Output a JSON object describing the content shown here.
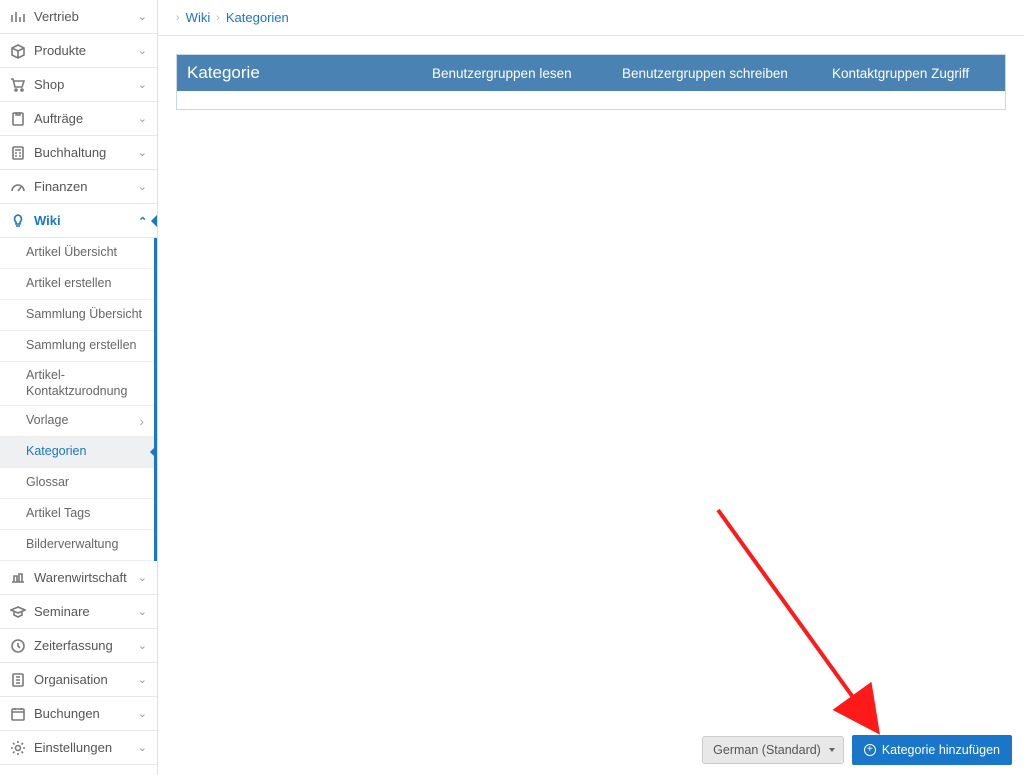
{
  "sidebar": {
    "items": [
      {
        "label": "Vertrieb",
        "icon": "bars-icon",
        "expandable": true
      },
      {
        "label": "Produkte",
        "icon": "box-icon",
        "expandable": true
      },
      {
        "label": "Shop",
        "icon": "cart-icon",
        "expandable": true
      },
      {
        "label": "Aufträge",
        "icon": "clipboard-icon",
        "expandable": true
      },
      {
        "label": "Buchhaltung",
        "icon": "calc-icon",
        "expandable": true
      },
      {
        "label": "Finanzen",
        "icon": "gauge-icon",
        "expandable": true
      },
      {
        "label": "Wiki",
        "icon": "bulb-icon",
        "expandable": true,
        "active": true,
        "children": [
          {
            "label": "Artikel Übersicht"
          },
          {
            "label": "Artikel erstellen"
          },
          {
            "label": "Sammlung Übersicht"
          },
          {
            "label": "Sammlung erstellen"
          },
          {
            "label": "Artikel-Kontaktzurodnung"
          },
          {
            "label": "Vorlage",
            "has_sub": true
          },
          {
            "label": "Kategorien",
            "active": true
          },
          {
            "label": "Glossar"
          },
          {
            "label": "Artikel Tags"
          },
          {
            "label": "Bilderverwaltung"
          }
        ]
      },
      {
        "label": "Warenwirtschaft",
        "icon": "pallet-icon",
        "expandable": true
      },
      {
        "label": "Seminare",
        "icon": "grad-icon",
        "expandable": true
      },
      {
        "label": "Zeiterfassung",
        "icon": "clock-icon",
        "expandable": true
      },
      {
        "label": "Organisation",
        "icon": "org-icon",
        "expandable": true
      },
      {
        "label": "Buchungen",
        "icon": "cal-icon",
        "expandable": true
      },
      {
        "label": "Einstellungen",
        "icon": "gear-icon",
        "expandable": true
      }
    ]
  },
  "breadcrumb": {
    "items": [
      {
        "label": "Wiki",
        "link": true
      },
      {
        "label": "Kategorien",
        "link": true
      }
    ]
  },
  "table": {
    "headers": {
      "category": "Kategorie",
      "read_groups": "Benutzergruppen lesen",
      "write_groups": "Benutzergruppen schreiben",
      "contact_groups": "Kontaktgruppen Zugriff"
    },
    "rows": []
  },
  "footer": {
    "language_selected": "German (Standard)",
    "add_button_label": "Kategorie hinzufügen"
  }
}
